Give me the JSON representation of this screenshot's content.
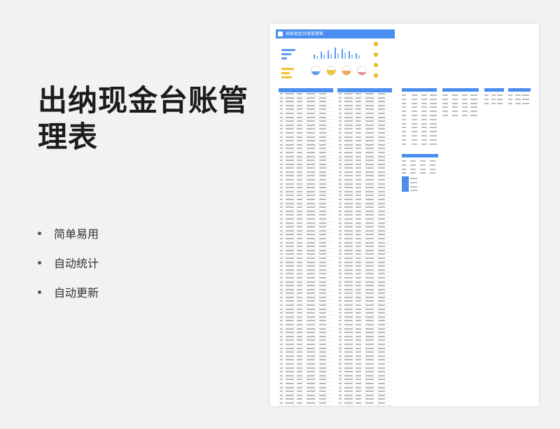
{
  "promo": {
    "title": "出纳现金台账管理表",
    "features": [
      "简单易用",
      "自动统计",
      "自动更新"
    ]
  },
  "sheet": {
    "header_title": "出纳现金台账管理表",
    "row_count": 80
  },
  "colors": {
    "accent": "#4a8ff0",
    "bar_blue": "#5b9af0",
    "bar_light": "#9fc4f5",
    "yellow": "#f2c230",
    "orange": "#f5a65b",
    "pink": "#f08a8a"
  }
}
